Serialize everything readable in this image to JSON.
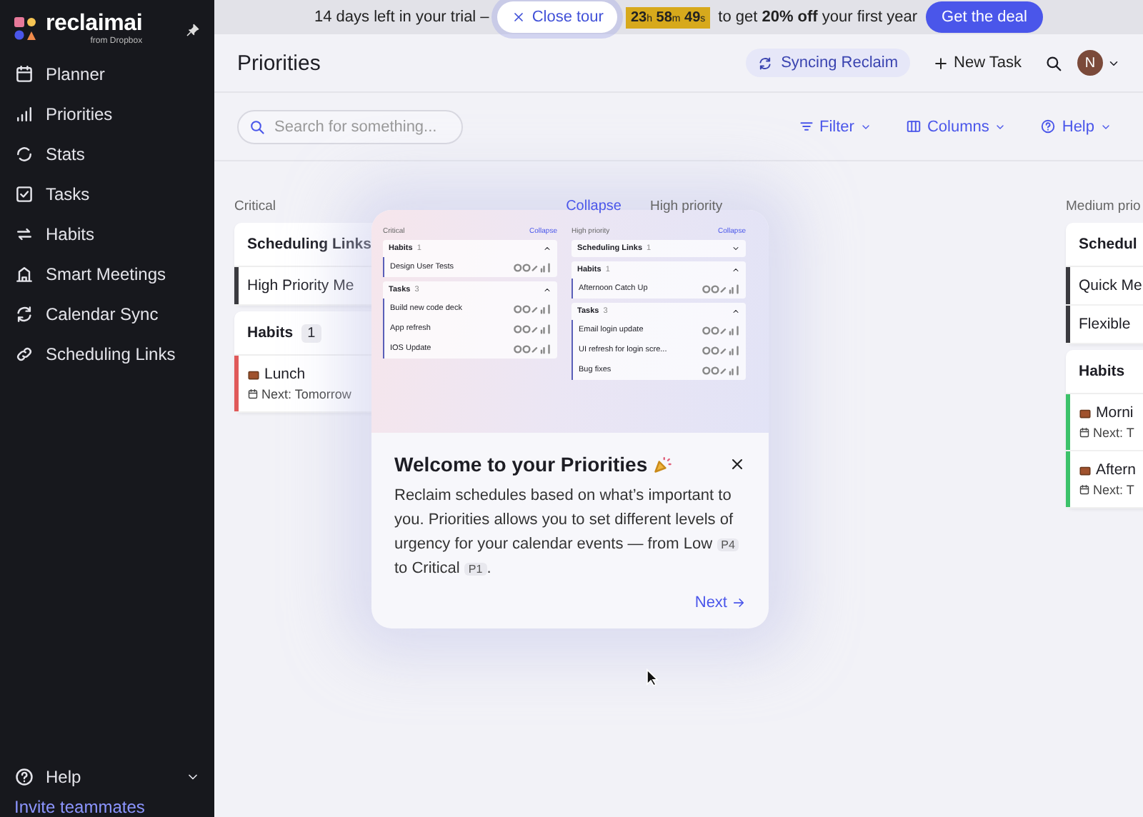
{
  "sidebar": {
    "logo": {
      "name": "reclaimai",
      "byline": "from Dropbox"
    },
    "items": [
      {
        "label": "Planner"
      },
      {
        "label": "Priorities"
      },
      {
        "label": "Stats"
      },
      {
        "label": "Tasks"
      },
      {
        "label": "Habits"
      },
      {
        "label": "Smart Meetings"
      },
      {
        "label": "Calendar Sync"
      },
      {
        "label": "Scheduling Links"
      }
    ],
    "footer": [
      {
        "label": "Help"
      },
      {
        "label": "Invite teammates"
      }
    ]
  },
  "banner": {
    "text": "14 days left in your trial –",
    "close_button": "Close tour",
    "timer": [
      {
        "value": "23",
        "unit": "h"
      },
      {
        "value": "58",
        "unit": "m"
      },
      {
        "value": "49",
        "unit": "s"
      }
    ],
    "offer": "to get **20% off** your first year",
    "deal_button": "Get the deal"
  },
  "header": {
    "title": "Priorities",
    "sync_status": "Syncing Reclaim",
    "new_task": "New Task",
    "avatar": "N"
  },
  "toolbar": {
    "search": {
      "placeholder": "Search for something..."
    },
    "menus": [
      "Filter",
      "Columns",
      "Help"
    ]
  },
  "board": {
    "columns": [
      {
        "label": "Critical",
        "action": "Collapse",
        "groups": [
          {
            "title": "Scheduling Links",
            "color": "#3a3a3f",
            "items": [
              {
                "name": "High Priority Me"
              }
            ]
          },
          {
            "title": "Habits",
            "count": "1",
            "color": "#e05a5a",
            "items": [
              {
                "name": "Lunch",
                "next": "Next: Tomorrow"
              }
            ]
          }
        ]
      },
      {
        "label": "High priority"
      },
      {
        "label": "Medium prio",
        "groups": [
          {
            "title": "Schedul",
            "color": "#3a3a3f",
            "items": [
              {
                "name": "Quick Me"
              },
              {
                "name": "Flexible"
              }
            ]
          },
          {
            "title": "Habits",
            "color": "#3cc26a",
            "items": [
              {
                "name": "Morni",
                "next": "Next: T"
              },
              {
                "name": "Aftern",
                "next": "Next: T"
              }
            ]
          }
        ]
      }
    ]
  },
  "tour": {
    "preview": {
      "columns": [
        {
          "label": "Critical",
          "action": "Collapse",
          "groups": [
            {
              "title": "Habits",
              "count": "1",
              "expanded": true,
              "items": [
                "Design User Tests"
              ]
            },
            {
              "title": "Tasks",
              "count": "3",
              "expanded": true,
              "items": [
                "Build new code deck",
                "App refresh",
                "IOS Update"
              ]
            }
          ]
        },
        {
          "label": "High priority",
          "action": "Collapse",
          "groups": [
            {
              "title": "Scheduling Links",
              "count": "1",
              "expanded": false
            },
            {
              "title": "Habits",
              "count": "1",
              "expanded": true,
              "items": [
                "Afternoon Catch Up"
              ]
            },
            {
              "title": "Tasks",
              "count": "3",
              "expanded": true,
              "items": [
                "Email login update",
                "UI refresh for login scre...",
                "Bug fixes"
              ]
            }
          ]
        }
      ]
    },
    "title": "Welcome to your Priorities",
    "body": [
      {
        "kind": "text",
        "text": "Reclaim schedules based on what’s important to you. Priorities allows you to set different levels of urgency for your calendar events — from Low "
      },
      {
        "kind": "tag",
        "text": "P4"
      },
      {
        "kind": "text",
        "text": " to Critical "
      },
      {
        "kind": "tag",
        "text": "P1"
      },
      {
        "kind": "text",
        "text": "."
      }
    ],
    "next": "Next"
  }
}
